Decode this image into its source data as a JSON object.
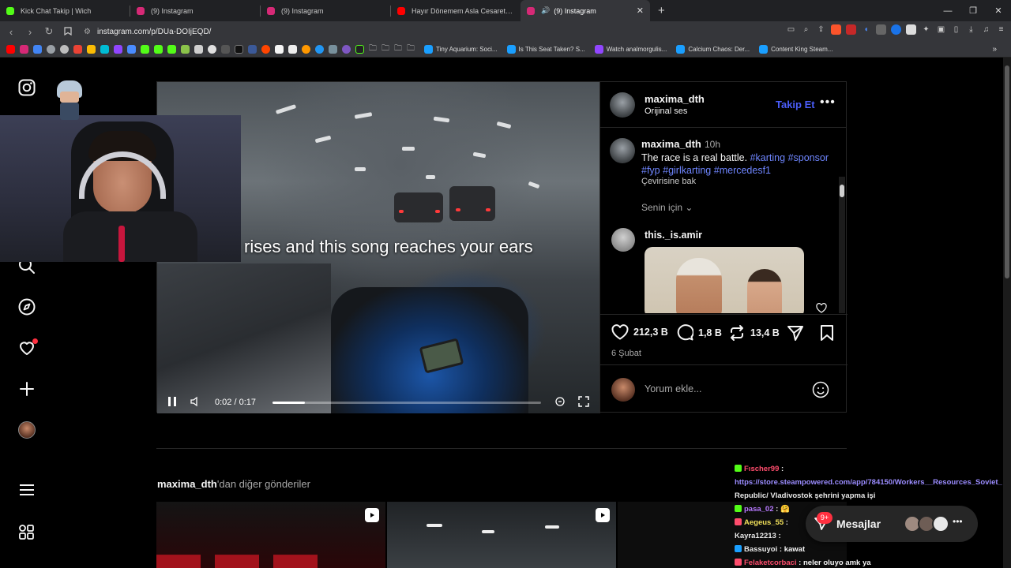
{
  "browser": {
    "tabs": [
      {
        "title": "Kick Chat Takip | Wich",
        "color": "#53fc18",
        "active": false
      },
      {
        "title": "(9) Instagram",
        "color": "#d62976",
        "active": false
      },
      {
        "title": "(9) Instagram",
        "color": "#d62976",
        "active": false
      },
      {
        "title": "Hayır Dönemem Asla Cesaretin Varsa",
        "color": "#ff0000",
        "active": false
      },
      {
        "title": "(9) Instagram",
        "color": "#d62976",
        "active": true
      }
    ],
    "new_tab": "+",
    "url": "instagram.com/p/DUa-DOIjEQD/",
    "bookmarks": [
      {
        "label": "Tiny Aquarium: Soci...",
        "color": "#1a9fff"
      },
      {
        "label": "Is This Seat Taken? S...",
        "color": "#1a9fff"
      },
      {
        "label": "Watch analmorgulis...",
        "color": "#9146ff"
      },
      {
        "label": "Calcium Chaos: Der...",
        "color": "#1a9fff"
      },
      {
        "label": "Content King Steam...",
        "color": "#1a9fff"
      }
    ],
    "bookmarks_more": "»"
  },
  "post": {
    "author": "maxima_dth",
    "audio": "Orijinal ses",
    "follow": "Takip Et",
    "more": "•••",
    "video": {
      "overlay_text": "rises and this song reaches your ears",
      "time": "0:02 / 0:17",
      "progress": 0.12
    },
    "caption": {
      "user": "maxima_dth",
      "time": "10h",
      "text": "The race is a real battle.",
      "tags": [
        "#karting",
        "#sponsor",
        "#fyp",
        "#girlkarting",
        "#mercedesf1"
      ],
      "translate": "Çevirisine bak"
    },
    "for_you": "Senin için",
    "comment_user": "this._is.amir",
    "stats": {
      "likes": "212,3 B",
      "comments": "1,8 B",
      "reposts": "13,4 B"
    },
    "date": "6 Şubat",
    "comment_placeholder": "Yorum ekle..."
  },
  "more_posts": {
    "user": "maxima_dth",
    "suffix": "'dan diğer gönderiler"
  },
  "chat": {
    "lines": [
      {
        "user": "Fıscher99",
        "user_color": "#ff4d6d",
        "badge_color": "#53fc18",
        "text": ""
      },
      {
        "user": "",
        "user_color": "#9b8cff",
        "badge_color": "",
        "text": "https://store.steampowered.com/app/784150/Workers__Resources_Soviet_"
      },
      {
        "user": "",
        "user_color": "#9b8cff",
        "badge_color": "",
        "text": "Republic/ Vladivostok şehrini yapma işi"
      },
      {
        "user": "pasa_02",
        "user_color": "#b779ff",
        "badge_color": "#53fc18",
        "text": "🤗"
      },
      {
        "user": "Aegeus_55",
        "user_color": "#f1e05a",
        "badge_color": "#ff4d6d",
        "text": ""
      },
      {
        "user": "Kayra12213",
        "user_color": "#e8e8e8",
        "badge_color": "",
        "text": ""
      },
      {
        "user": "Bassuyoi",
        "user_color": "#e8e8e8",
        "badge_color": "#1a9fff",
        "text": "kawat"
      },
      {
        "user": "Felaketcorbaci",
        "user_color": "#ff4d6d",
        "badge_color": "#ff4d6d",
        "text": "neler oluyo amk ya"
      }
    ]
  },
  "messages": {
    "label": "Mesajlar",
    "badge": "9+"
  }
}
